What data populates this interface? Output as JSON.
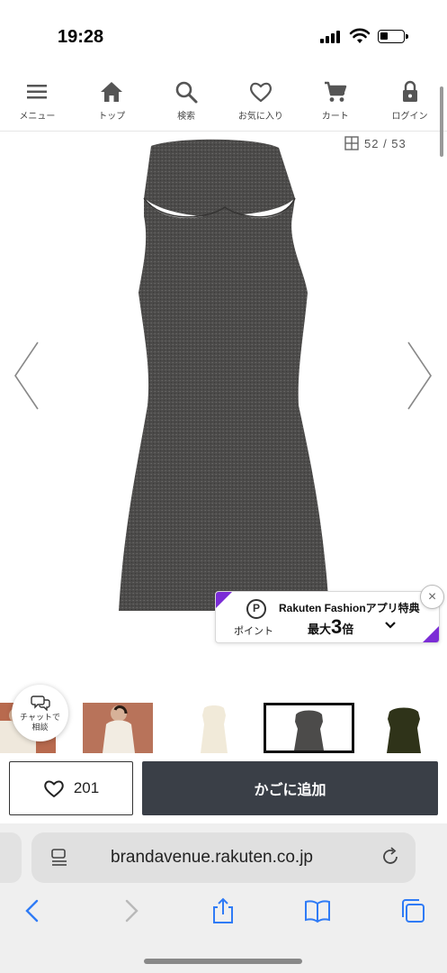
{
  "status_bar": {
    "time": "19:28"
  },
  "nav": {
    "items": [
      {
        "label": "メニュー",
        "icon": "hamburger-icon"
      },
      {
        "label": "トップ",
        "icon": "home-icon"
      },
      {
        "label": "検索",
        "icon": "search-icon"
      },
      {
        "label": "お気に入り",
        "icon": "heart-icon"
      },
      {
        "label": "カート",
        "icon": "cart-icon"
      },
      {
        "label": "ログイン",
        "icon": "lock-icon"
      }
    ]
  },
  "gallery": {
    "counter": "52 / 53"
  },
  "promo": {
    "title": "Rakuten Fashionアプリ特典",
    "point_label": "ポイント",
    "main_prefix": "最大",
    "main_number": "3",
    "main_suffix": "倍",
    "close_label": "×"
  },
  "chat": {
    "line1": "チャットで",
    "line2": "相談"
  },
  "actions": {
    "like_count": "201",
    "add_to_cart": "かごに追加"
  },
  "browser": {
    "url": "brandavenue.rakuten.co.jp"
  },
  "colors": {
    "cart_button": "#3a3f47",
    "promo_accent": "#7b2cd6",
    "product_knit": "#4a4948",
    "browser_blue": "#2f7bf6"
  }
}
